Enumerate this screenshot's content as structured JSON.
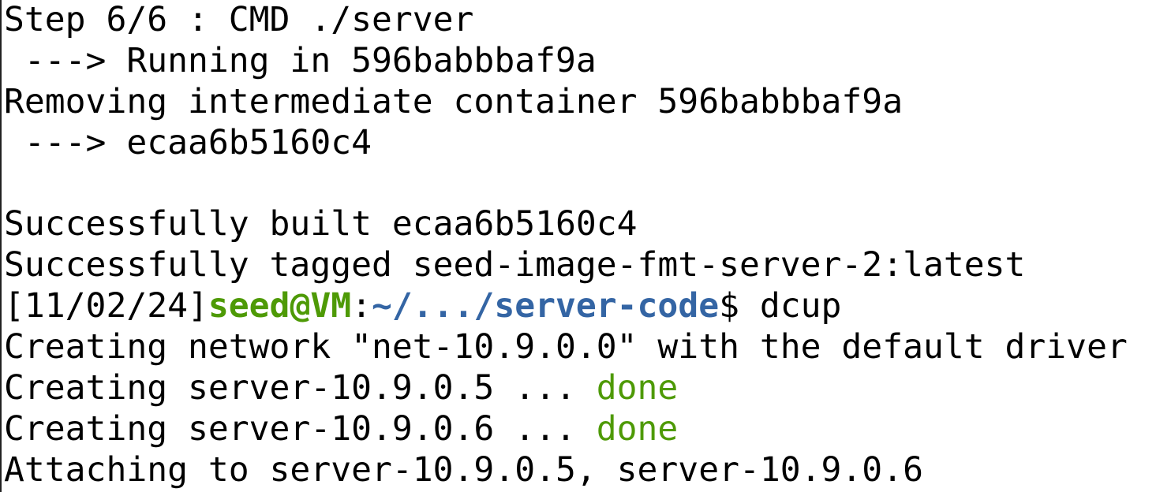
{
  "terminal": {
    "lines": {
      "l1": "Step 6/6 : CMD ./server",
      "l2": " ---> Running in 596babbbaf9a",
      "l3": "Removing intermediate container 596babbbaf9a",
      "l4": " ---> ecaa6b5160c4",
      "l5": "",
      "l6": "Successfully built ecaa6b5160c4",
      "l7": "Successfully tagged seed-image-fmt-server-2:latest",
      "l8": {
        "date": "[11/02/24]",
        "user": "seed@VM",
        "sep": ":",
        "path": "~/.../server-code",
        "dollar": "$ ",
        "command": "dcup"
      },
      "l9": "Creating network \"net-10.9.0.0\" with the default driver",
      "l10": {
        "text": "Creating server-10.9.0.5 ... ",
        "status": "done"
      },
      "l11": {
        "text": "Creating server-10.9.0.6 ... ",
        "status": "done"
      },
      "l12": "Attaching to server-10.9.0.5, server-10.9.0.6"
    },
    "colors": {
      "prompt_user": "#4e9a06",
      "prompt_path": "#3465a4",
      "status_done": "#4e9a06"
    }
  }
}
